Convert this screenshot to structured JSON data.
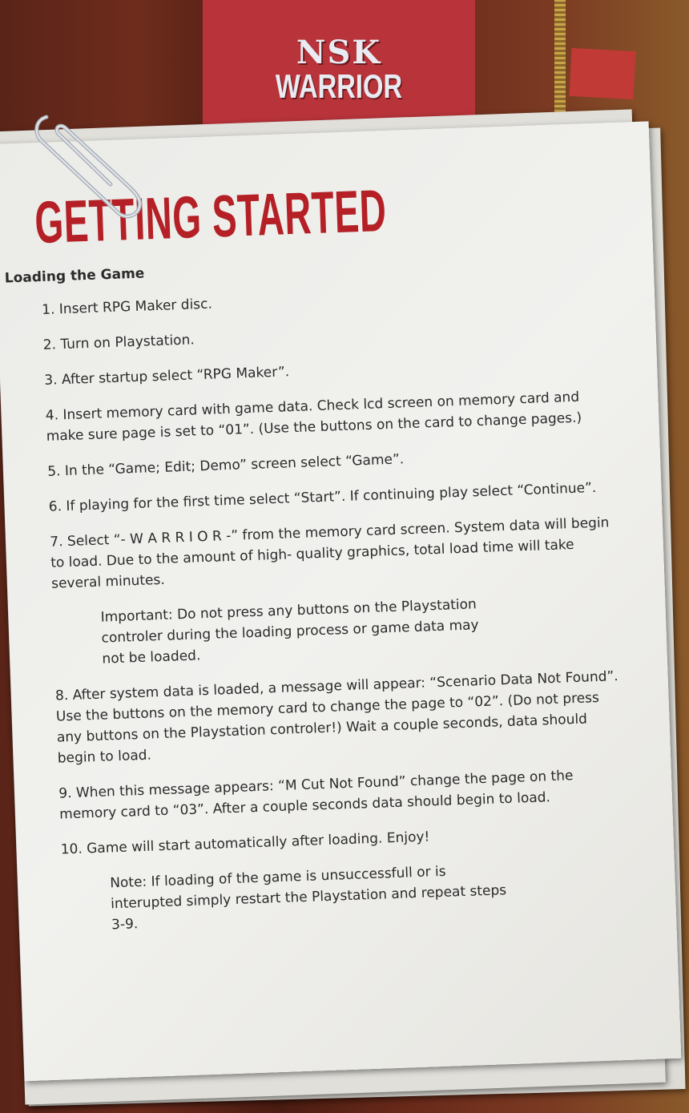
{
  "header": {
    "logo_line1": "NSK",
    "logo_line2": "WARRIOR"
  },
  "page": {
    "title": "GETTING STARTED",
    "section": "Loading the Game",
    "steps": [
      {
        "lines": [
          "1. Insert RPG Maker disc."
        ]
      },
      {
        "lines": [
          "2. Turn on Playstation."
        ]
      },
      {
        "lines": [
          "3. After startup select “RPG Maker”."
        ]
      },
      {
        "lines": [
          "4. Insert memory card with game data.  Check lcd screen on  memory card and",
          "make sure page is set to “01”. (Use the  buttons on the card to change pages.)"
        ]
      },
      {
        "lines": [
          "5. In the “Game; Edit; Demo” screen select “Game”."
        ]
      },
      {
        "lines": [
          "6. If playing for the first time select “Start”.  If continuing play select “Continue”."
        ]
      },
      {
        "lines": [
          "7. Select “- W A R R I O R -” from the memory card screen.  System data will begin",
          "to load.  Due to the amount of high- quality graphics, total load time will take",
          "several minutes."
        ]
      },
      {
        "note": true,
        "lines": [
          "Important:  Do not press any buttons on the Playstation",
          "controler during the loading process or game data may",
          "not be loaded."
        ]
      },
      {
        "lines": [
          "8. After system data is loaded, a message will appear: “Scenario Data Not Found”.",
          "Use the buttons on the memory card to change the page to “02”. (Do not press",
          "any buttons on the Playstation controler!)  Wait a couple seconds, data should",
          "begin to load."
        ]
      },
      {
        "lines": [
          "9. When this message appears: “M Cut Not Found” change the page on the",
          "memory card to “03”.  After a couple seconds data should begin to load."
        ]
      },
      {
        "lines": [
          "10. Game will start automatically after loading.  Enjoy!"
        ]
      },
      {
        "note": true,
        "lines": [
          "Note:  If loading of the game is unsuccessfull or is",
          "interupted simply restart the Playstation and repeat steps",
          "3-9."
        ]
      }
    ]
  }
}
